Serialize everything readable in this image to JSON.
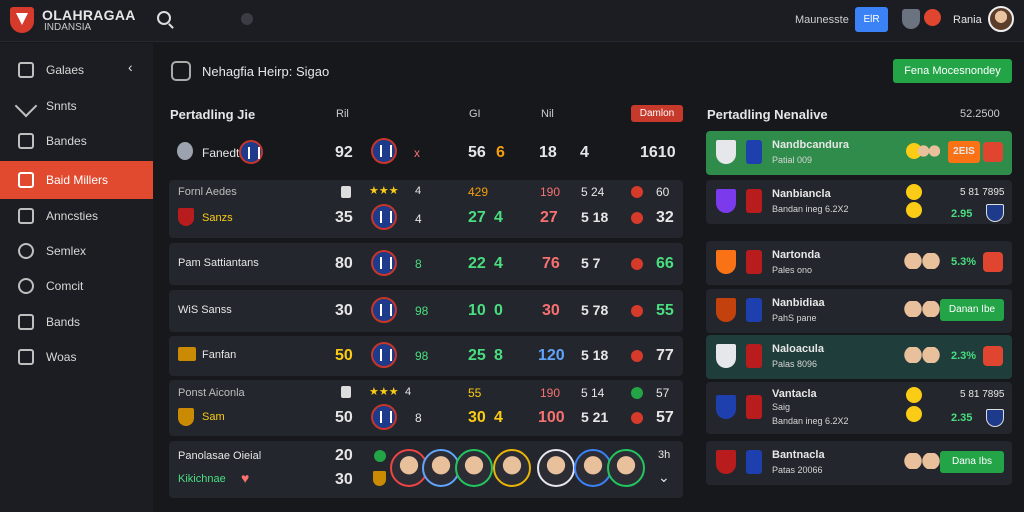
{
  "header": {
    "brand_line1": "OLAHRAGAA",
    "brand_line2": "INDANSIA",
    "user_label": "Maunesste",
    "btn_label": "ElR",
    "user_name": "Rania"
  },
  "sidebar": {
    "items": [
      {
        "label": "Galaes"
      },
      {
        "label": "Snnts"
      },
      {
        "label": "Bandes"
      },
      {
        "label": "Baid Millers"
      },
      {
        "label": "Anncsties"
      },
      {
        "label": "Semlex"
      },
      {
        "label": "Comcit"
      },
      {
        "label": "Bands"
      },
      {
        "label": "Woas"
      }
    ]
  },
  "main": {
    "title": "Nehagfia Heirp: Sigao",
    "action_button": "Fena Mocesnondey",
    "section_title": "Pertadling Jie",
    "col_h1": "Ril",
    "col_h2": "GI",
    "col_h3": "Nil",
    "tag": "Damlon",
    "rows": [
      {
        "name": "Fanedt",
        "score": "92",
        "x": "x",
        "v1": "56",
        "v1b": "6",
        "v2": "18",
        "v2b": "4",
        "v3": "1610"
      },
      {
        "name_top": "Fornl Aedes",
        "stars_top": "4",
        "name": "Sanzs",
        "score": "35",
        "mid": "4",
        "v1top": "429",
        "v1": "27",
        "v1b": "4",
        "v2top": "190",
        "v2": "27",
        "v2b": "5 18",
        "v3top": "60",
        "v3": "32",
        "v2btop": "5 24"
      },
      {
        "name": "Pam Sattiantans",
        "score": "80",
        "mid": "8",
        "v1": "22",
        "v1b": "4",
        "v2": "76",
        "v2b": "5 7",
        "v3": "66"
      },
      {
        "name": "WiS Sanss",
        "score": "30",
        "mid": "98",
        "v1": "10",
        "v1b": "0",
        "v2": "30",
        "v2b": "5 78",
        "v3": "55"
      },
      {
        "name": "Fanfan",
        "score": "50",
        "mid": "98",
        "v1": "25",
        "v1b": "8",
        "v2": "120",
        "v2b": "5 18",
        "v3": "77"
      },
      {
        "name_top": "Ponst Aiconla",
        "stars_top": "4",
        "name": "Sam",
        "score": "50",
        "mid": "8",
        "v1top": "55",
        "v1": "30",
        "v1b": "4",
        "v2top": "190",
        "v2": "100",
        "v2b": "5 21",
        "v3top": "57",
        "v3": "57",
        "v2btop": "5 14"
      },
      {
        "name": "Panolasae Oieial",
        "name2": "Kikichnae",
        "score": "20",
        "score2": "30",
        "v3": "3h"
      }
    ]
  },
  "panel": {
    "title": "Pertadling Nenalive",
    "right": "52.2500",
    "cards": [
      {
        "name": "Nandbcandura",
        "sub": "Patial 009",
        "pct": "2EIS"
      },
      {
        "name": "Nanbiancla",
        "sub": "Bandan ineg 6.2X2",
        "pct_top": "5 81 7895",
        "pct": "2.95"
      },
      {
        "name": "Nartonda",
        "sub": "Pales ono",
        "pct": "5.3%"
      },
      {
        "name": "Nanbidiaa",
        "sub": "PahS pane",
        "btn": "Danan Ibe"
      },
      {
        "name": "Naloacula",
        "sub": "Palas 8096",
        "pct": "2.3%"
      },
      {
        "name": "Vantacla",
        "sub2": "Saig",
        "sub": "Bandan ineg 6.2X2",
        "pct_top": "5 81 7895",
        "pct": "2.35"
      },
      {
        "name": "Bantnacla",
        "sub": "Patas 20066",
        "btn": "Dana Ibs"
      }
    ]
  },
  "colors": {
    "accent_red": "#e14a2e",
    "accent_green": "#22a447",
    "accent_blue": "#3b82f6"
  }
}
